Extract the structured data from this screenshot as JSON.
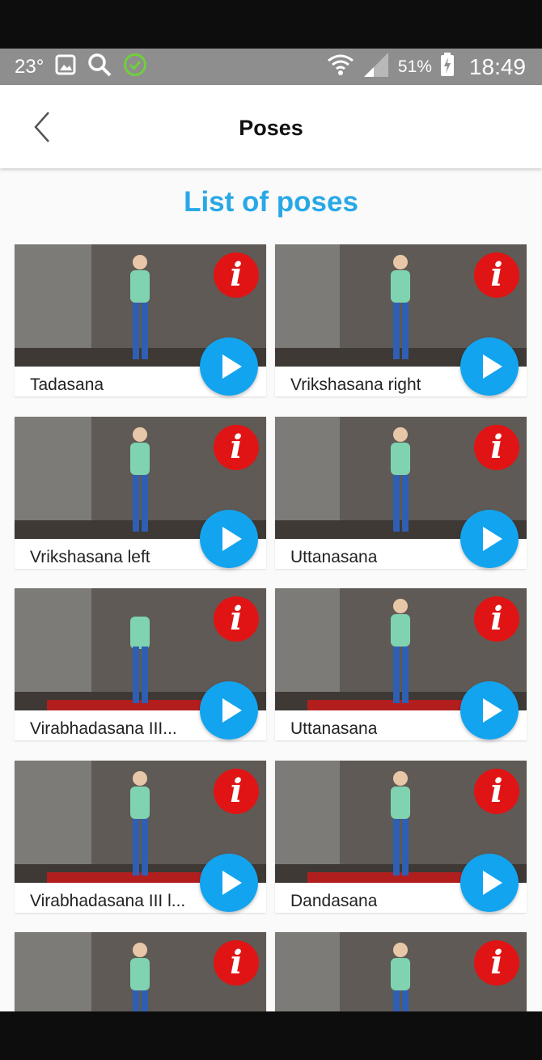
{
  "status_bar": {
    "temperature": "23°",
    "battery_percent": "51%",
    "time": "18:49",
    "icons": [
      "image-icon",
      "search-icon",
      "check-circle-icon",
      "wifi-icon",
      "signal-icon",
      "battery-charging-icon"
    ]
  },
  "appbar": {
    "title": "Poses",
    "back_icon": "chevron-left-icon"
  },
  "heading": "List of poses",
  "colors": {
    "heading": "#29a8e6",
    "info_button": "#e01414",
    "play_button": "#13a4ef",
    "status_bar": "#8e8e8e"
  },
  "poses": [
    {
      "label": "Tadasana"
    },
    {
      "label": "Vrikshasana right"
    },
    {
      "label": "Vrikshasana left"
    },
    {
      "label": "Uttanasana"
    },
    {
      "label": "Virabhadasana III..."
    },
    {
      "label": "Uttanasana"
    },
    {
      "label": "Virabhadasana III l..."
    },
    {
      "label": "Dandasana"
    },
    {
      "label": ""
    },
    {
      "label": ""
    }
  ],
  "info_glyph": "i"
}
